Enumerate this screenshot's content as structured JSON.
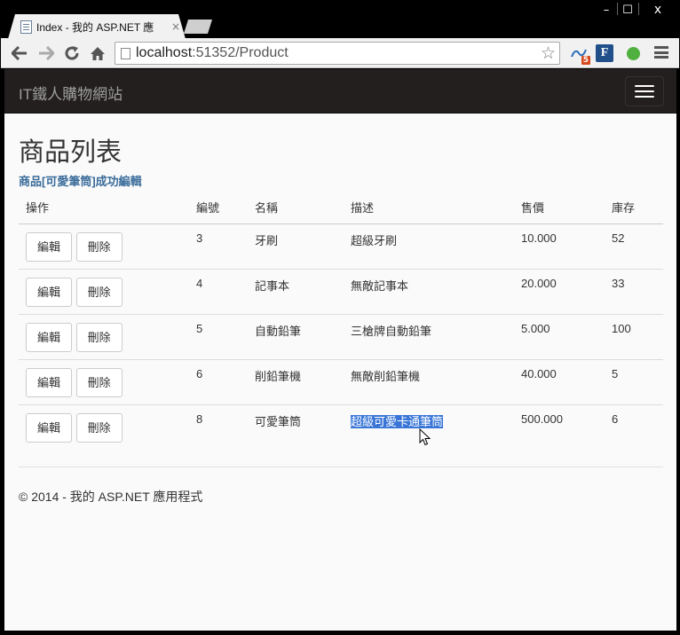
{
  "browser": {
    "tab_title": "Index - 我的 ASP.NET 應",
    "tab_close": "×",
    "url_host": "localhost",
    "url_path": ":51352/Product",
    "ext_badge": "5",
    "ext_f": "F",
    "win_min": "–",
    "win_max": "☐",
    "win_close": "x"
  },
  "site": {
    "brand": "IT鐵人購物網站",
    "page_title": "商品列表",
    "flash_message": "商品[可愛筆筒]成功編輯",
    "footer": "© 2014 - 我的 ASP.NET 應用程式"
  },
  "table": {
    "headers": [
      "操作",
      "編號",
      "名稱",
      "描述",
      "售價",
      "庫存"
    ],
    "edit_label": "編輯",
    "delete_label": "刪除",
    "rows": [
      {
        "id": "3",
        "name": "牙刷",
        "desc": "超級牙刷",
        "price": "10.000",
        "stock": "52"
      },
      {
        "id": "4",
        "name": "記事本",
        "desc": "無敵記事本",
        "price": "20.000",
        "stock": "33"
      },
      {
        "id": "5",
        "name": "自動鉛筆",
        "desc": "三槍牌自動鉛筆",
        "price": "5.000",
        "stock": "100"
      },
      {
        "id": "6",
        "name": "削鉛筆機",
        "desc": "無敵削鉛筆機",
        "price": "40.000",
        "stock": "5"
      },
      {
        "id": "8",
        "name": "可愛筆筒",
        "desc": "超級可愛卡通筆筒",
        "price": "500.000",
        "stock": "6"
      }
    ]
  },
  "colors": {
    "navbar": "#221f1e",
    "flash": "#3a6c9a",
    "selection": "#3875d7"
  }
}
